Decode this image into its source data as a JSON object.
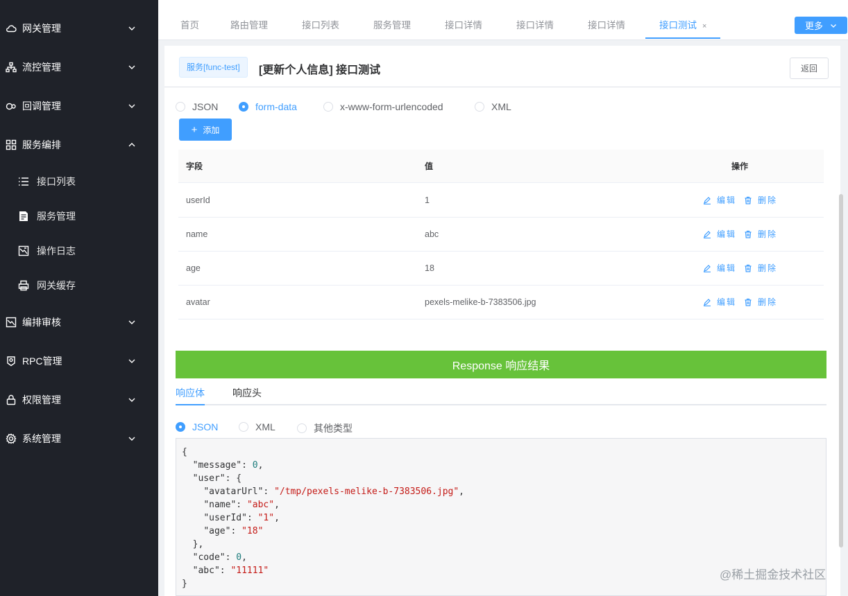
{
  "sidebar": {
    "items": [
      {
        "label": "网关管理",
        "icon": "cloud-icon"
      },
      {
        "label": "流控管理",
        "icon": "hierarchy-icon"
      },
      {
        "label": "回调管理",
        "icon": "link-icon"
      },
      {
        "label": "服务编排",
        "icon": "grid-icon",
        "expanded": true
      },
      {
        "label": "编排审核",
        "icon": "image-icon"
      },
      {
        "label": "RPC管理",
        "icon": "badge-icon"
      },
      {
        "label": "权限管理",
        "icon": "lock-icon"
      },
      {
        "label": "系统管理",
        "icon": "gear-icon"
      }
    ],
    "subitems": [
      {
        "label": "接口列表",
        "icon": "list-icon"
      },
      {
        "label": "服务管理",
        "icon": "document-icon"
      },
      {
        "label": "操作日志",
        "icon": "picture-icon"
      },
      {
        "label": "网关缓存",
        "icon": "printer-icon"
      }
    ]
  },
  "tabs": [
    {
      "label": "首页"
    },
    {
      "label": "路由管理"
    },
    {
      "label": "接口列表"
    },
    {
      "label": "服务管理"
    },
    {
      "label": "接口详情"
    },
    {
      "label": "接口详情"
    },
    {
      "label": "接口详情"
    },
    {
      "label": "接口测试",
      "active": true
    }
  ],
  "tab_close": "×",
  "more_label": "更多",
  "header": {
    "service_tag": "服务[func-test]",
    "title": "[更新个人信息] 接口测试",
    "back_label": "返回"
  },
  "body_types": [
    {
      "label": "JSON",
      "checked": false
    },
    {
      "label": "form-data",
      "checked": true
    },
    {
      "label": "x-www-form-urlencoded",
      "checked": false
    },
    {
      "label": "XML",
      "checked": false
    }
  ],
  "add_label": "添加",
  "table": {
    "headers": {
      "field": "字段",
      "value": "值",
      "ops": "操作"
    },
    "rows": [
      {
        "field": "userId",
        "value": "1"
      },
      {
        "field": "name",
        "value": "abc"
      },
      {
        "field": "age",
        "value": "18"
      },
      {
        "field": "avatar",
        "value": "pexels-melike-b-7383506.jpg"
      }
    ],
    "edit_label": "编辑",
    "delete_label": "删除"
  },
  "response": {
    "banner": "Response 响应结果",
    "tabs": [
      {
        "label": "响应体",
        "active": true
      },
      {
        "label": "响应头",
        "active": false
      }
    ],
    "formats": [
      {
        "label": "JSON",
        "checked": true
      },
      {
        "label": "XML",
        "checked": false
      },
      {
        "label": "其他类型",
        "checked": false
      }
    ],
    "body_lines": [
      "{",
      "  \"message\": 0,",
      "  \"user\": {",
      "    \"avatarUrl\": \"/tmp/pexels-melike-b-7383506.jpg\",",
      "    \"name\": \"abc\",",
      "    \"userId\": \"1\",",
      "    \"age\": \"18\"",
      "  },",
      "  \"code\": 0,",
      "  \"abc\": \"11111\"",
      "}"
    ]
  },
  "watermark": "@稀土掘金技术社区",
  "colors": {
    "sidebar_bg": "#1f2229",
    "primary": "#409eff",
    "success": "#67c23a"
  }
}
